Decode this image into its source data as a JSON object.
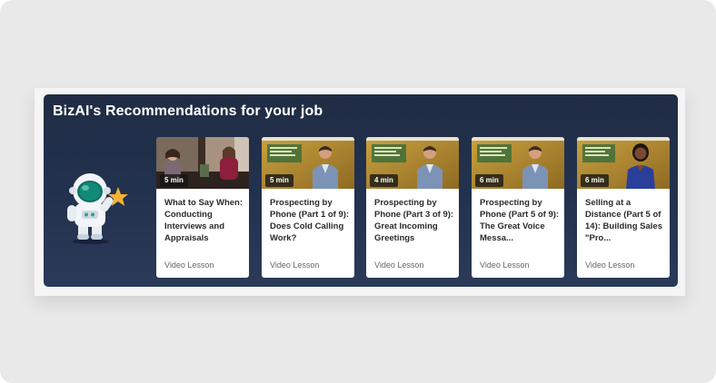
{
  "recommendations": {
    "title": "BizAI's Recommendations for your job",
    "cards": [
      {
        "duration": "5 min",
        "title": "What to Say When: Conducting Interviews and Appraisals",
        "type": "Video Lesson",
        "thumbnail": "interview-scene"
      },
      {
        "duration": "5 min",
        "title": "Prospecting by Phone (Part 1 of 9): Does Cold Calling Work?",
        "type": "Video Lesson",
        "thumbnail": "presenter-man"
      },
      {
        "duration": "4 min",
        "title": "Prospecting by Phone (Part 3 of 9): Great Incoming Greetings",
        "type": "Video Lesson",
        "thumbnail": "presenter-man"
      },
      {
        "duration": "6 min",
        "title": "Prospecting by Phone (Part 5 of 9): The Great Voice Messa...",
        "type": "Video Lesson",
        "thumbnail": "presenter-man"
      },
      {
        "duration": "6 min",
        "title": "Selling at a Distance (Part 5 of 14): Building Sales \"Pro...",
        "type": "Video Lesson",
        "thumbnail": "presenter-woman"
      }
    ]
  },
  "mascot": {
    "icon": "astronaut-with-star-icon"
  },
  "colors": {
    "panel_bg": "#1f2c44",
    "card_bg": "#ffffff",
    "star": "#f5b335"
  }
}
